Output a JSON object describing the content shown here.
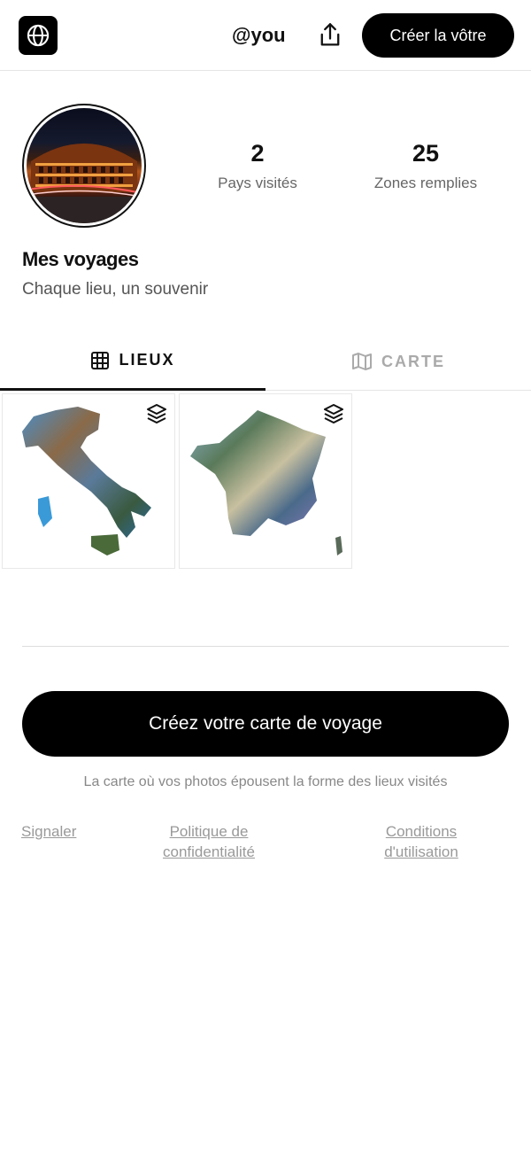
{
  "header": {
    "logo_icon": "globe-icon",
    "username": "@you",
    "share_icon": "share-icon",
    "create_label": "Créer la vôtre"
  },
  "profile": {
    "avatar": "colosseum-photo",
    "stats": [
      {
        "value": "2",
        "label": "Pays visités"
      },
      {
        "value": "25",
        "label": "Zones remplies"
      }
    ],
    "title": "Mes voyages",
    "subtitle": "Chaque lieu, un souvenir"
  },
  "tabs": [
    {
      "label": "LIEUX",
      "icon": "grid-icon",
      "active": true
    },
    {
      "label": "CARTE",
      "icon": "map-icon",
      "active": false
    }
  ],
  "grid": {
    "items": [
      {
        "name": "italy-map",
        "icon": "layers-icon"
      },
      {
        "name": "france-map",
        "icon": "layers-icon"
      }
    ]
  },
  "cta": {
    "label": "Créez votre carte de voyage",
    "tagline": "La carte où vos photos épousent la forme des lieux visités"
  },
  "footer": {
    "report": "Signaler",
    "privacy": "Politique de confidentialité",
    "terms": "Conditions d'utilisation"
  },
  "colors": {
    "primary": "#000000",
    "text_muted": "#666666",
    "tab_inactive": "#aaaaaa",
    "divider": "#e5e5e5"
  }
}
